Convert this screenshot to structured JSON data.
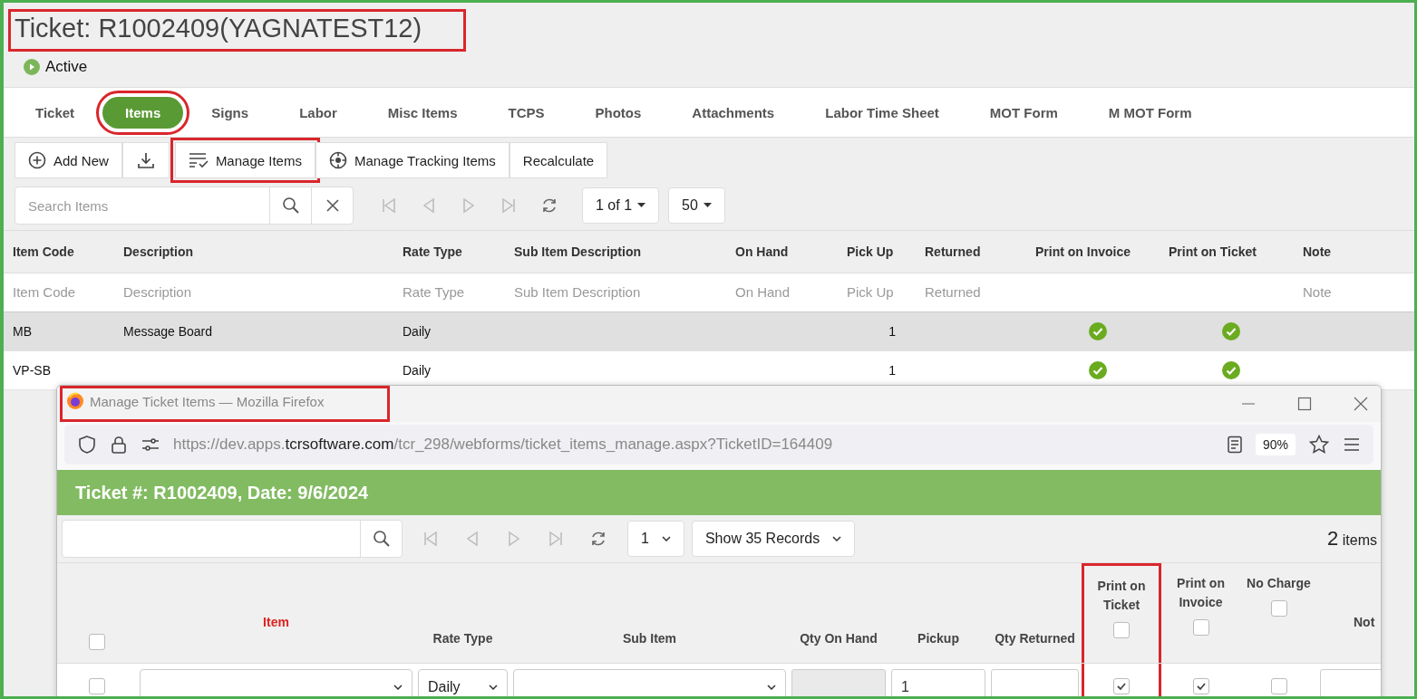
{
  "title": {
    "text": "Ticket: R1002409(YAGNATEST12)",
    "annotated": true
  },
  "status": {
    "label": "Active"
  },
  "tabs": [
    {
      "label": "Ticket",
      "selected": false,
      "annotated": false
    },
    {
      "label": "Items",
      "selected": true,
      "annotated": true
    },
    {
      "label": "Signs",
      "selected": false,
      "annotated": false
    },
    {
      "label": "Labor",
      "selected": false,
      "annotated": false
    },
    {
      "label": "Misc Items",
      "selected": false,
      "annotated": false
    },
    {
      "label": "TCPS",
      "selected": false,
      "annotated": false
    },
    {
      "label": "Photos",
      "selected": false,
      "annotated": false
    },
    {
      "label": "Attachments",
      "selected": false,
      "annotated": false
    },
    {
      "label": "Labor Time Sheet",
      "selected": false,
      "annotated": false
    },
    {
      "label": "MOT Form",
      "selected": false,
      "annotated": false
    },
    {
      "label": "M MOT Form",
      "selected": false,
      "annotated": false
    }
  ],
  "toolbar": [
    {
      "kind": "add",
      "label": "Add New",
      "annotated": false
    },
    {
      "kind": "download",
      "annotated": false
    },
    {
      "kind": "manage",
      "label": "Manage Items",
      "annotated": true
    },
    {
      "kind": "tracking",
      "label": "Manage Tracking Items",
      "annotated": false
    },
    {
      "kind": "plain",
      "label": "Recalculate",
      "annotated": false
    }
  ],
  "search": {
    "placeholder": "Search Items"
  },
  "pager": {
    "page": "1 of 1",
    "page_size": "50"
  },
  "table": {
    "columns": [
      {
        "label": "Item Code",
        "placeholder": "Item Code"
      },
      {
        "label": "Description",
        "placeholder": "Description"
      },
      {
        "label": "Rate Type",
        "placeholder": "Rate Type"
      },
      {
        "label": "Sub Item Description",
        "placeholder": "Sub Item Description"
      },
      {
        "label": "On Hand",
        "placeholder": "On Hand"
      },
      {
        "label": "Pick Up",
        "placeholder": "Pick Up"
      },
      {
        "label": "Returned",
        "placeholder": "Returned"
      },
      {
        "label": "Print on Invoice"
      },
      {
        "label": "Print on Ticket"
      },
      {
        "label": "Note",
        "placeholder": "Note"
      }
    ],
    "rows": [
      {
        "item_code": "MB",
        "description": "Message Board",
        "rate_type": "Daily",
        "pick_up": "1",
        "print_on_invoice": true,
        "print_on_ticket": true,
        "selected": true
      },
      {
        "item_code": "VP-SB",
        "rate_type": "Daily",
        "pick_up": "1",
        "print_on_invoice": true,
        "print_on_ticket": true,
        "selected": false
      }
    ]
  },
  "popup": {
    "window_title": "Manage Ticket Items — Mozilla Firefox",
    "annotated": true,
    "url": {
      "prefix": "https://dev.apps.",
      "domain": "tcrsoftware.com",
      "path": "/tcr_298/webforms/ticket_items_manage.aspx?TicketID=164409"
    },
    "zoom": "90%",
    "header": "Ticket #: R1002409, Date: 9/6/2024",
    "page": "1",
    "page_size": "Show 35 Records",
    "count": "2",
    "count_label": "items",
    "select_all": {
      "checked": false
    },
    "columns": [
      {
        "kind": "text",
        "label": "Item",
        "required": true
      },
      {
        "kind": "text",
        "label": "Rate Type",
        "required": false
      },
      {
        "kind": "text",
        "label": "Sub Item",
        "required": false
      },
      {
        "kind": "text",
        "label": "Qty On Hand",
        "required": false
      },
      {
        "kind": "text",
        "label": "Pickup",
        "required": false
      },
      {
        "kind": "text",
        "label": "Qty Returned",
        "required": false
      },
      {
        "kind": "check",
        "label": "Print on Ticket",
        "checked": false,
        "annotated": true
      },
      {
        "kind": "check",
        "label": "Print on Invoice",
        "checked": false
      },
      {
        "kind": "check",
        "label": "No Charge",
        "checked": false
      },
      {
        "kind": "text",
        "label": "Not",
        "required": false
      }
    ],
    "row": {
      "checked": false,
      "cells": [
        {
          "kind": "select"
        },
        {
          "kind": "select",
          "value": "Daily"
        },
        {
          "kind": "select"
        },
        {
          "kind": "input",
          "disabled": true
        },
        {
          "kind": "input",
          "value": "1",
          "disabled": false
        },
        {
          "kind": "input",
          "disabled": false
        },
        {
          "kind": "checkbox",
          "checked": true
        },
        {
          "kind": "checkbox",
          "checked": true
        },
        {
          "kind": "checkbox",
          "checked": false
        },
        {
          "kind": "input",
          "disabled": false
        }
      ]
    }
  }
}
